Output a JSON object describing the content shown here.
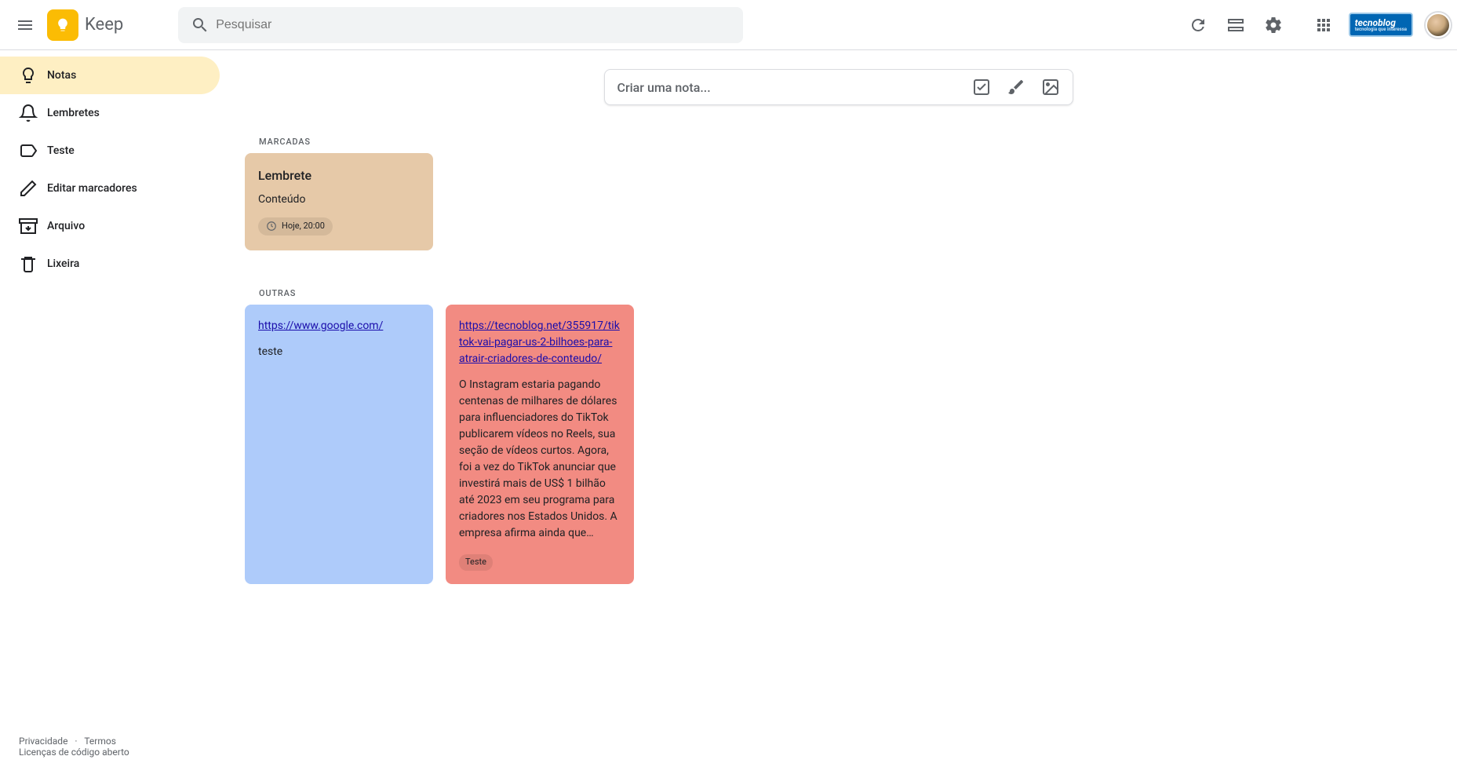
{
  "header": {
    "app_name": "Keep",
    "search_placeholder": "Pesquisar",
    "extension_name": "tecnoblog",
    "extension_tagline": "tecnologia que interessa"
  },
  "sidebar": {
    "items": [
      {
        "label": "Notas",
        "icon": "lightbulb",
        "active": true
      },
      {
        "label": "Lembretes",
        "icon": "bell",
        "active": false
      },
      {
        "label": "Teste",
        "icon": "label",
        "active": false
      },
      {
        "label": "Editar marcadores",
        "icon": "pencil",
        "active": false
      },
      {
        "label": "Arquivo",
        "icon": "archive",
        "active": false
      },
      {
        "label": "Lixeira",
        "icon": "trash",
        "active": false
      }
    ]
  },
  "create_note": {
    "placeholder": "Criar uma nota..."
  },
  "sections": {
    "pinned_label": "MARCADAS",
    "others_label": "OUTRAS"
  },
  "pinned_notes": [
    {
      "title": "Lembrete",
      "body": "Conteúdo",
      "reminder": "Hoje, 20:00",
      "color": "tan"
    }
  ],
  "other_notes": [
    {
      "link": "https://www.google.com/",
      "body": "teste",
      "color": "blue"
    },
    {
      "link": "https://tecnoblog.net/355917/tiktok-vai-pagar-us-2-bilhoes-para-atrair-criadores-de-conteudo/",
      "body": "O Instagram estaria pagando centenas de milhares de dólares para influenciadores do TikTok publicarem vídeos no Reels, sua seção de vídeos curtos. Agora, foi a vez do TikTok anunciar que investirá mais de US$ 1 bilhão até 2023 em seu programa para criadores nos Estados Unidos. A empresa afirma ainda que…",
      "label": "Teste",
      "color": "red"
    }
  ],
  "footer": {
    "privacy": "Privacidade",
    "terms": "Termos",
    "licenses": "Licenças de código aberto"
  }
}
